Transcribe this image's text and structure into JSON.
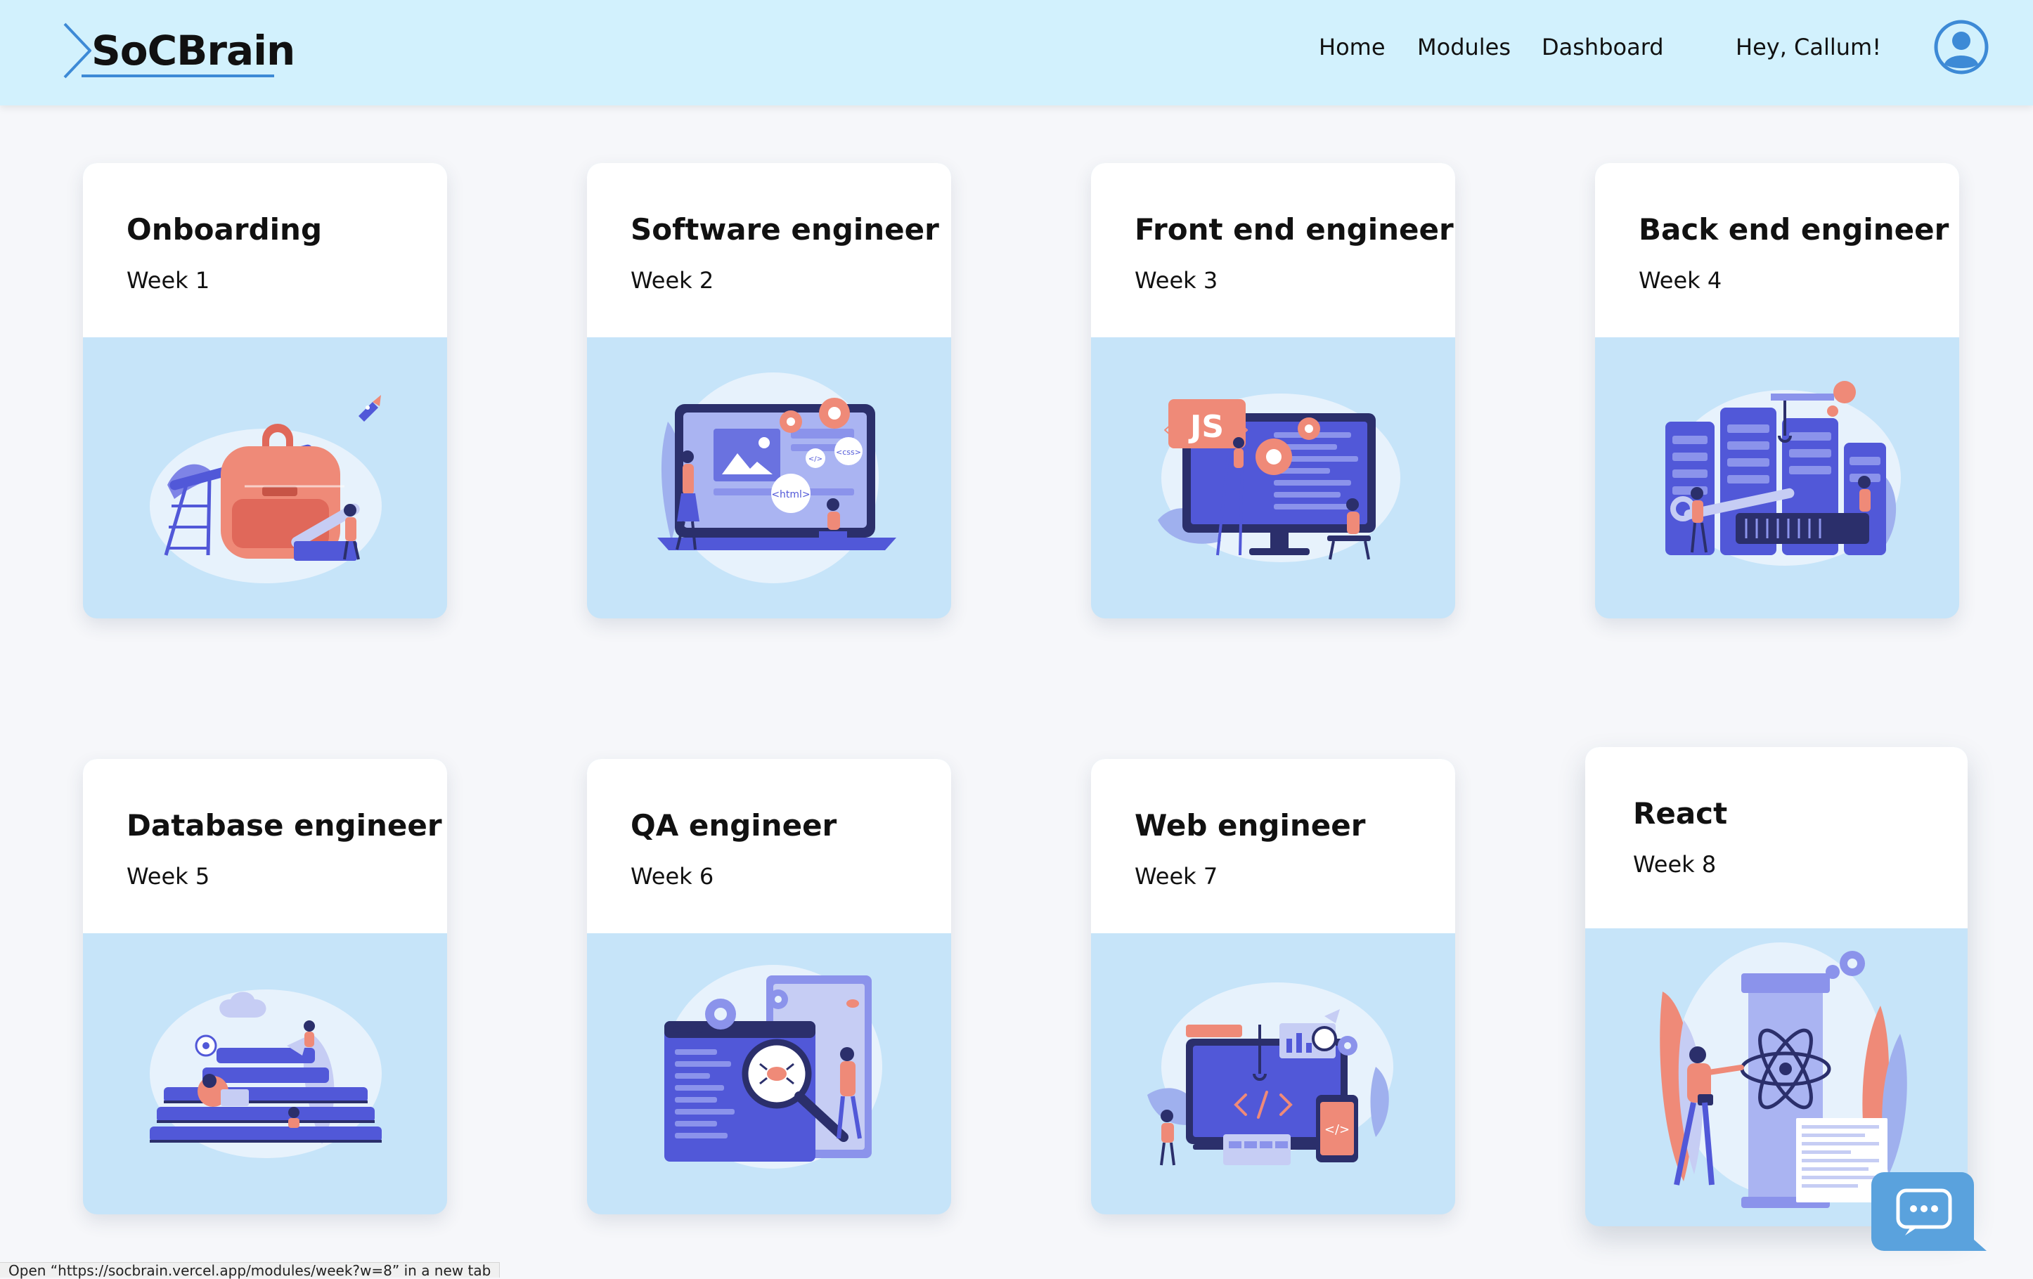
{
  "brand": {
    "name": "SoCBrain"
  },
  "nav": {
    "links": [
      "Home",
      "Modules",
      "Dashboard"
    ],
    "greeting": "Hey, Callum!"
  },
  "modules": [
    {
      "title": "Onboarding",
      "week": "Week 1",
      "illustration": "backpack-rocket-illustration"
    },
    {
      "title": "Software engineer",
      "week": "Week 2",
      "illustration": "laptop-html-css-illustration"
    },
    {
      "title": "Front end engineer",
      "week": "Week 3",
      "illustration": "js-monitor-illustration"
    },
    {
      "title": "Back end engineer",
      "week": "Week 4",
      "illustration": "server-rack-illustration"
    },
    {
      "title": "Database engineer",
      "week": "Week 5",
      "illustration": "database-stack-illustration"
    },
    {
      "title": "QA engineer",
      "week": "Week 6",
      "illustration": "magnifier-bug-illustration"
    },
    {
      "title": "Web engineer",
      "week": "Week 7",
      "illustration": "web-devices-illustration"
    },
    {
      "title": "React",
      "week": "Week 8",
      "illustration": "react-atom-illustration"
    }
  ],
  "status_bar": {
    "text": "Open “https://socbrain.vercel.app/modules/week?w=8” in a new tab"
  },
  "chat": {
    "icon": "chat-bubble-icon"
  },
  "colors": {
    "navbar_bg": "#d2f1fd",
    "page_bg": "#f6f7fa",
    "card_illustration_bg": "#c6e4f9",
    "accent_blue": "#3d8ad6",
    "illustration_indigo": "#5158d8",
    "illustration_coral": "#ef8a78"
  }
}
